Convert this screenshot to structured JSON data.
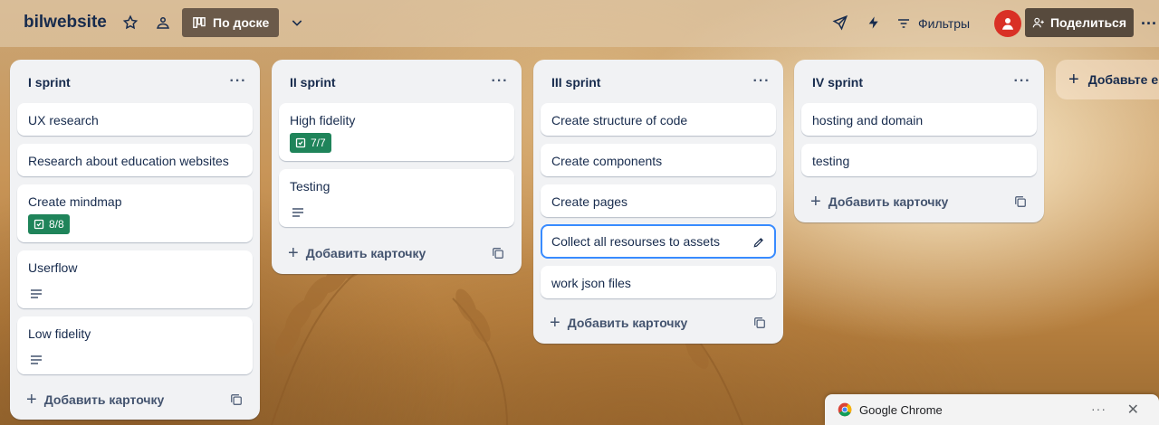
{
  "header": {
    "board_title": "bilwebsite",
    "view_label": "По доске",
    "filters_label": "Фильтры",
    "share_label": "Поделиться",
    "more_label": "···"
  },
  "lists": [
    {
      "title": "I sprint",
      "menu": "···",
      "cards": [
        {
          "title": "UX research"
        },
        {
          "title": "Research about education websites"
        },
        {
          "title": "Create mindmap",
          "checklist": "8/8"
        },
        {
          "title": "Userflow",
          "has_description": true
        },
        {
          "title": "Low fidelity",
          "has_description": true
        }
      ],
      "add_card_label": "Добавить карточку"
    },
    {
      "title": "II sprint",
      "menu": "···",
      "cards": [
        {
          "title": "High fidelity",
          "checklist": "7/7"
        },
        {
          "title": "Testing",
          "has_description": true
        }
      ],
      "add_card_label": "Добавить карточку"
    },
    {
      "title": "III sprint",
      "menu": "···",
      "cards": [
        {
          "title": "Create structure of code"
        },
        {
          "title": "Create components"
        },
        {
          "title": "Create pages"
        },
        {
          "title": "Collect all resourses to assets",
          "focused": true
        },
        {
          "title": "work json files"
        }
      ],
      "add_card_label": "Добавить карточку"
    },
    {
      "title": "IV sprint",
      "menu": "···",
      "cards": [
        {
          "title": "hosting and domain"
        },
        {
          "title": "testing"
        }
      ],
      "add_card_label": "Добавить карточку"
    }
  ],
  "add_list_label": "Добавьте еще колонку",
  "chrome_popup": {
    "title": "Google Chrome",
    "menu": "···",
    "close": "✕"
  },
  "colors": {
    "checklist_complete": "#1f845a",
    "focus_ring": "#388bff",
    "list_bg": "#f1f2f4",
    "share_button": "#574a3d"
  }
}
